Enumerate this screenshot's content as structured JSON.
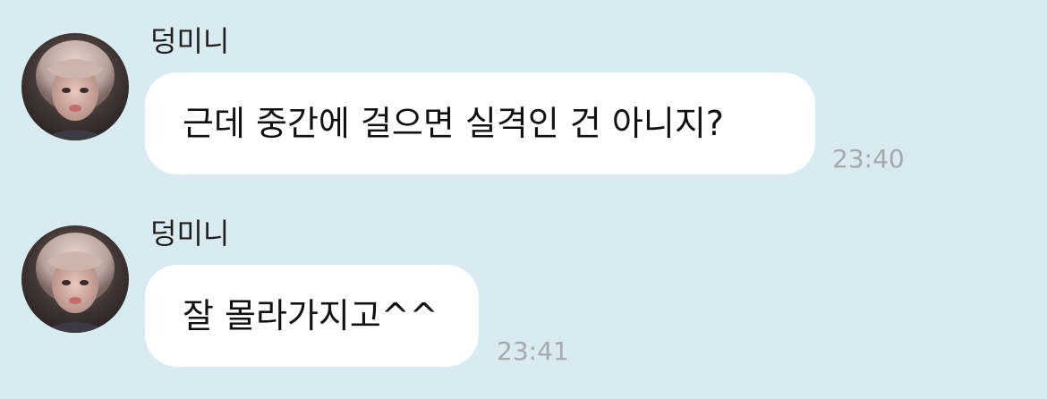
{
  "chat": {
    "messages": [
      {
        "sender": "덩미니",
        "text": "근데 중간에 걸으면 실격인 건 아니지?",
        "time": "23:40"
      },
      {
        "sender": "덩미니",
        "text": "잘 몰라가지고^^",
        "time": "23:41"
      }
    ]
  },
  "colors": {
    "background": "#d9eaf0",
    "bubble": "#ffffff",
    "timestamp": "#a3a9ad",
    "text": "#111111"
  }
}
